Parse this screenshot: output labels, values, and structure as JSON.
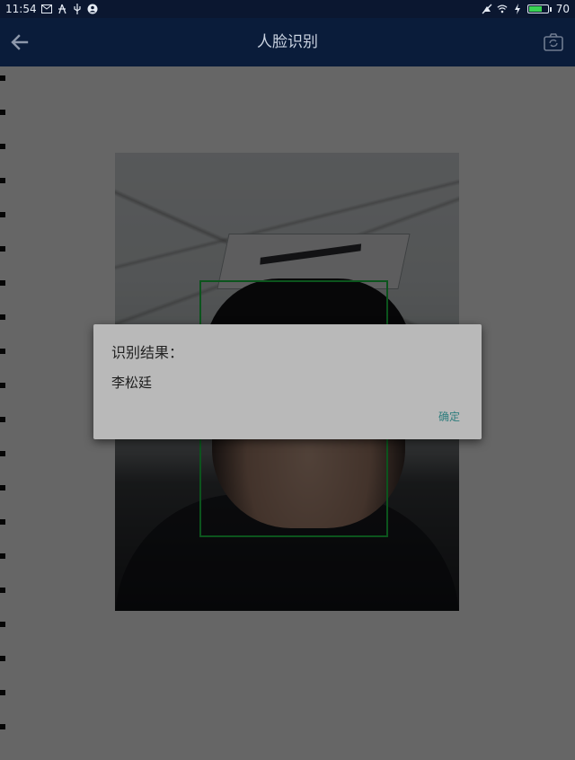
{
  "status_bar": {
    "time": "11:54",
    "battery_level": "70",
    "battery_fraction": 0.7,
    "icons": [
      "mail-icon",
      "person-icon",
      "usb-icon",
      "account-icon",
      "silent-icon",
      "wifi-icon",
      "charging-icon",
      "battery-icon"
    ]
  },
  "toolbar": {
    "title": "人脸识别",
    "back_icon": "back-arrow-icon",
    "camera_icon": "switch-camera-icon"
  },
  "content": {
    "face_box_color": "#1fd14a"
  },
  "dialog": {
    "title": "识别结果：",
    "message": "李松廷",
    "ok_label": "确定"
  },
  "colors": {
    "toolbar_bg": "#0a1c3a",
    "accent_text": "#2e7d7d"
  }
}
